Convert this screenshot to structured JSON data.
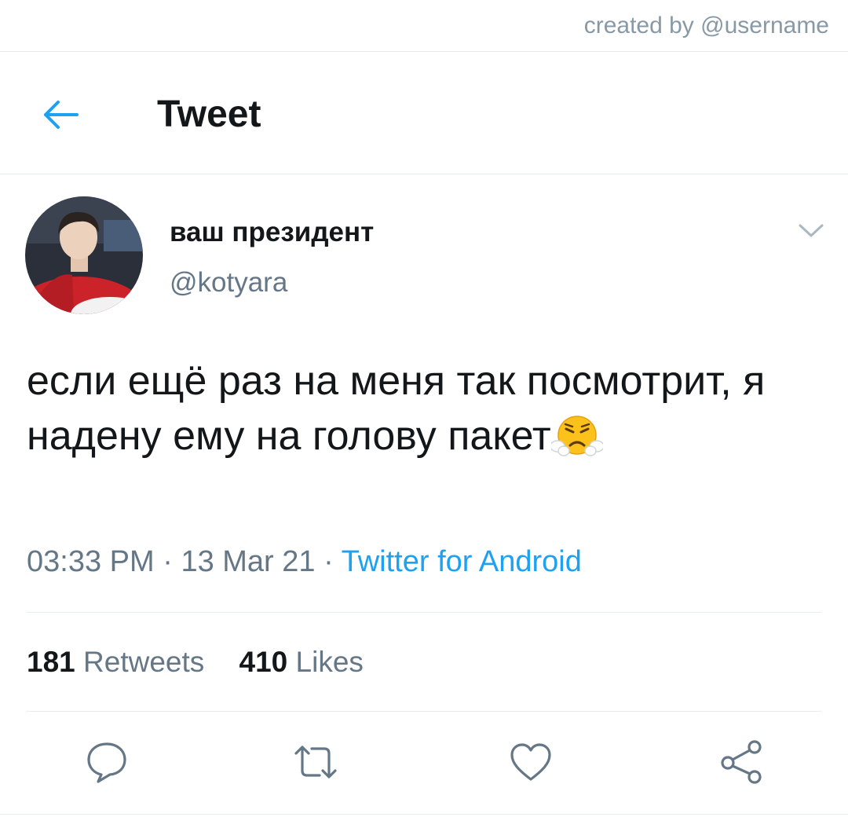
{
  "credit": "created by @username",
  "header": {
    "title": "Tweet",
    "back_icon": "arrow-left-icon"
  },
  "author": {
    "display_name": "ваш президент",
    "handle": "@kotyara"
  },
  "tweet": {
    "text": "если ещё раз на меня так посмотрит, я надену ему на голову пакет",
    "emoji": "face-with-steam-from-nose-emoji"
  },
  "meta": {
    "time": "03:33 PM",
    "separator": "·",
    "date": "13 Mar 21",
    "source": "Twitter for Android"
  },
  "stats": {
    "retweets_count": "181",
    "retweets_label": "Retweets",
    "likes_count": "410",
    "likes_label": "Likes"
  },
  "actions": [
    "reply-icon",
    "retweet-icon",
    "like-icon",
    "share-icon"
  ],
  "colors": {
    "accent": "#1da1f2",
    "text": "#14171a",
    "secondary": "#657786",
    "divider": "#e6ecf0"
  }
}
